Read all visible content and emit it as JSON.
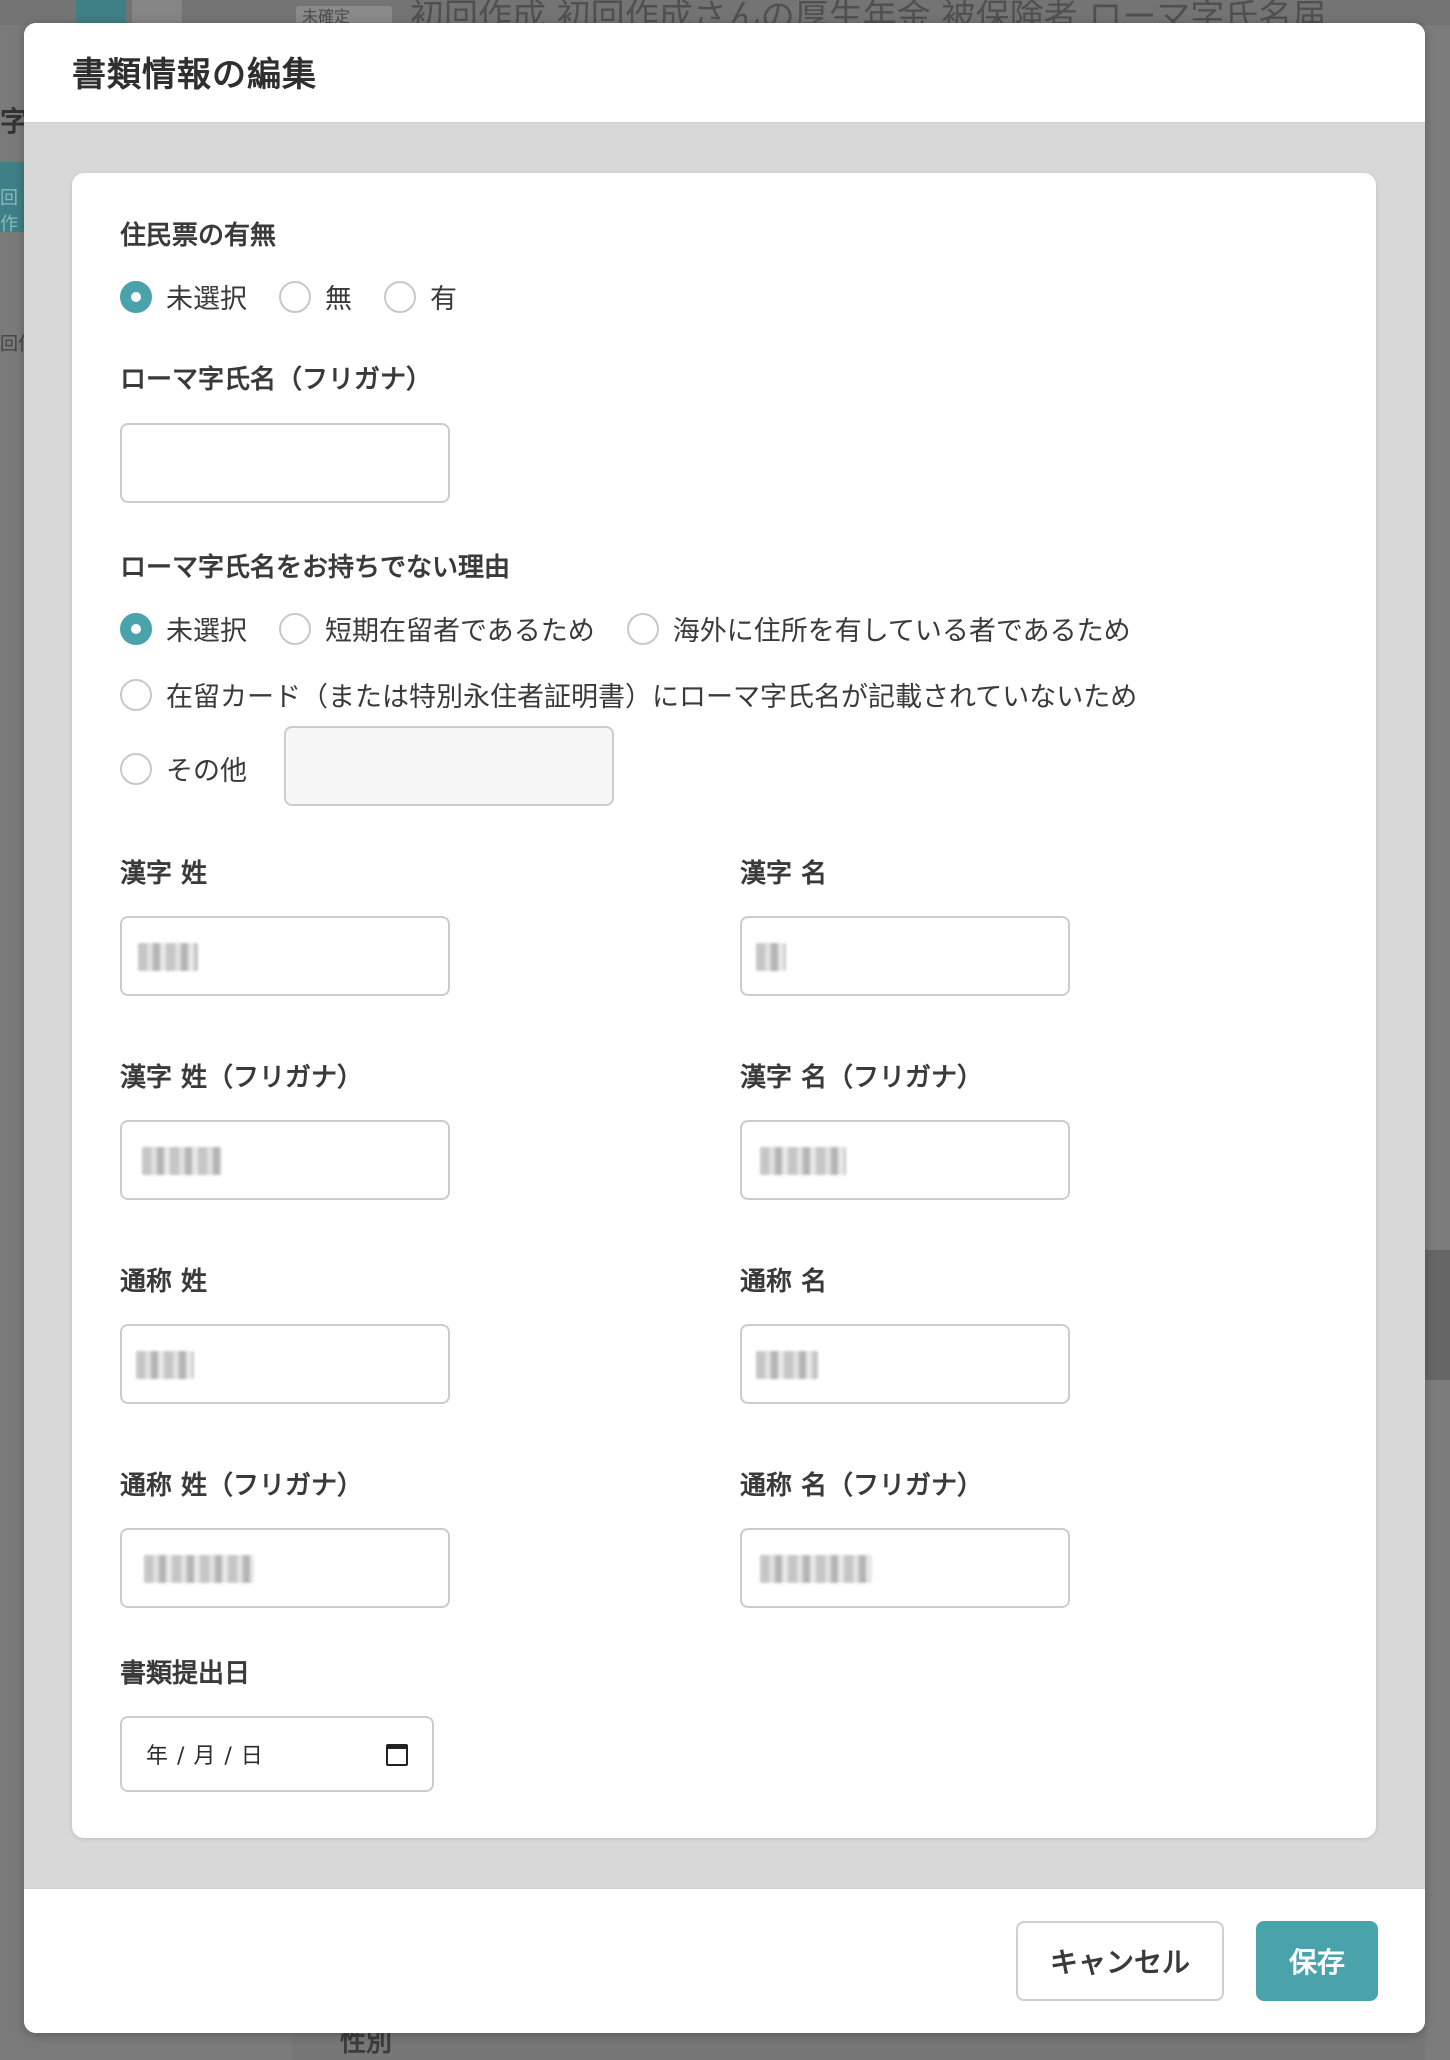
{
  "background": {
    "tag": "未確定",
    "title": "初回作成 初回作成さんの厚生年金 被保険者 ローマ字氏名届",
    "side_char": "字",
    "side_tab": "回作",
    "side_small": "回作",
    "bottom_label": "性別"
  },
  "modal": {
    "title": "書類情報の編集",
    "residence": {
      "label": "住民票の有無",
      "options": [
        "未選択",
        "無",
        "有"
      ],
      "selected": 0
    },
    "roman_name": {
      "label": "ローマ字氏名（フリガナ）",
      "value": ""
    },
    "reason": {
      "label": "ローマ字氏名をお持ちでない理由",
      "options": [
        "未選択",
        "短期在留者であるため",
        "海外に住所を有している者であるため",
        "在留カード（または特別永住者証明書）にローマ字氏名が記載されていないため",
        "その他"
      ],
      "selected": 0,
      "other_value": ""
    },
    "fields": {
      "kanji_last": "漢字 姓",
      "kanji_first": "漢字 名",
      "kanji_last_kana": "漢字 姓（フリガナ）",
      "kanji_first_kana": "漢字 名（フリガナ）",
      "alias_last": "通称 姓",
      "alias_first": "通称 名",
      "alias_last_kana": "通称 姓（フリガナ）",
      "alias_first_kana": "通称 名（フリガナ）"
    },
    "submit_date": {
      "label": "書類提出日",
      "placeholder": "年 / 月 / 日"
    },
    "buttons": {
      "cancel": "キャンセル",
      "save": "保存"
    }
  },
  "colors": {
    "accent": "#4aa3aa",
    "overlay": "#7a7a7a"
  },
  "icons": {
    "calendar": "calendar-icon"
  }
}
